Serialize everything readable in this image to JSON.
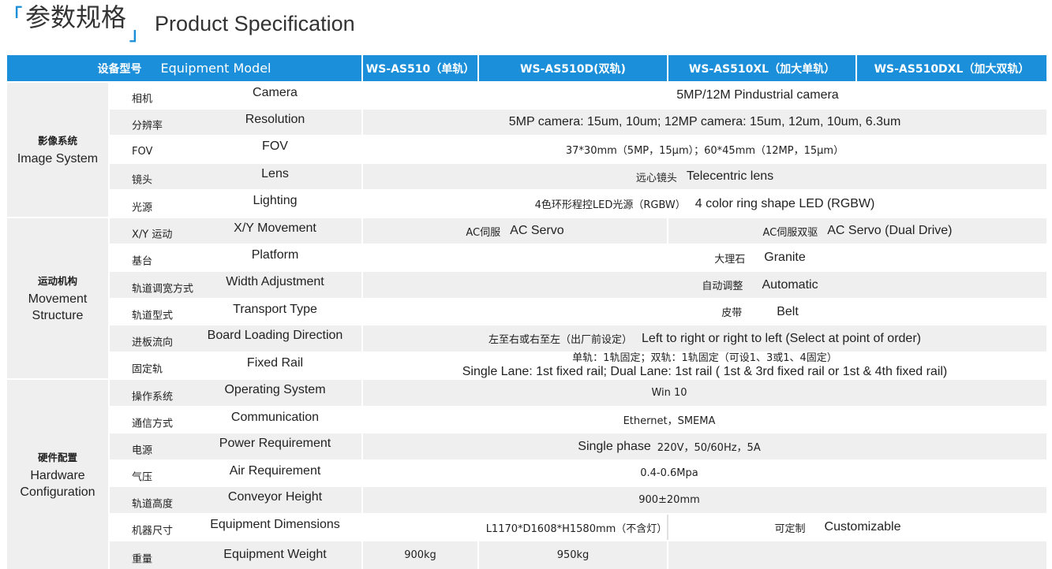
{
  "title": {
    "cn": "参数规格",
    "en": "Product Specification",
    "bracket_left": "「",
    "bracket_right": "」"
  },
  "colors": {
    "accent": "#1b8fd9",
    "row_alt": "#efefef"
  },
  "header": {
    "equipment_model_cn": "设备型号",
    "equipment_model_en": "Equipment Model",
    "models": [
      "WS-AS510（单轨）",
      "WS-AS510D(双轨)",
      "WS-AS510XL（加大单轨）",
      "WS-AS510DXL（加大双轨）"
    ]
  },
  "categories": {
    "image": {
      "cn": "影像系统",
      "en": "Image System"
    },
    "movement": {
      "cn": "运动机构",
      "en_1": "Movement",
      "en_2": "Structure"
    },
    "hardware": {
      "cn": "硬件配置",
      "en_1": "Hardware",
      "en_2": "Configuration"
    }
  },
  "rows": {
    "camera": {
      "cn": "相机",
      "en": "Camera",
      "value": "5MP/12M Pindustrial camera"
    },
    "resolution": {
      "cn": "分辨率",
      "en": "Resolution",
      "value": "5MP camera: 15um, 10um; 12MP camera: 15um, 12um, 10um, 6.3um"
    },
    "fov": {
      "cn": "FOV",
      "en": "FOV",
      "value": "37*30mm（5MP，15μm）；60*45mm（12MP，15μm）"
    },
    "lens": {
      "cn": "镜头",
      "en": "Lens",
      "value_cn": "远心镜头",
      "value_en": "Telecentric lens"
    },
    "lighting": {
      "cn": "光源",
      "en": "Lighting",
      "value_cn": "4色环形程控LED光源（RGBW）",
      "value_en": "4 color ring shape LED (RGBW)"
    },
    "xy": {
      "cn": "X/Y 运动",
      "en": "X/Y Movement",
      "left_cn": "AC伺服",
      "left_en": "AC Servo",
      "right_cn": "AC伺服双驱",
      "right_en": "AC Servo (Dual Drive)"
    },
    "platform": {
      "cn": "基台",
      "en": "Platform",
      "value_cn": "大理石",
      "value_en": "Granite"
    },
    "width": {
      "cn": "轨道调宽方式",
      "en": "Width Adjustment",
      "value_cn": "自动调整",
      "value_en": "Automatic"
    },
    "transport": {
      "cn": "轨道型式",
      "en": "Transport Type",
      "value_cn": "皮带",
      "value_en": "Belt"
    },
    "loading": {
      "cn": "进板流向",
      "en": "Board Loading Direction",
      "value_cn": "左至右或右至左（出厂前设定）",
      "value_en": "Left to right or right to left (Select at point of order)"
    },
    "fixed": {
      "cn": "固定轨",
      "en": "Fixed Rail",
      "value_cn": "单轨：1轨固定；双轨：1轨固定（可设1、3或1、4固定）",
      "value_en": "Single Lane: 1st fixed rail; Dual Lane: 1st rail ( 1st & 3rd fixed rail or 1st & 4th fixed rail)"
    },
    "os": {
      "cn": "操作系统",
      "en": "Operating System",
      "value": "Win 10"
    },
    "comm": {
      "cn": "通信方式",
      "en": "Communication",
      "value": "Ethernet，SMEMA"
    },
    "power": {
      "cn": "电源",
      "en": "Power Requirement",
      "value_en": "Single phase",
      "value_sm": "220V，50/60Hz，5A"
    },
    "air": {
      "cn": "气压",
      "en": "Air Requirement",
      "value": "0.4-0.6Mpa"
    },
    "height": {
      "cn": "轨道高度",
      "en": "Conveyor Height",
      "value": "900±20mm"
    },
    "dimensions": {
      "cn": "机器尺寸",
      "en": "Equipment Dimensions",
      "left": "L1170*D1608*H1580mm（不含灯）",
      "right_cn": "可定制",
      "right_en": "Customizable"
    },
    "weight": {
      "cn": "重量",
      "en": "Equipment Weight",
      "v1": "900kg",
      "v2": "950kg"
    }
  }
}
